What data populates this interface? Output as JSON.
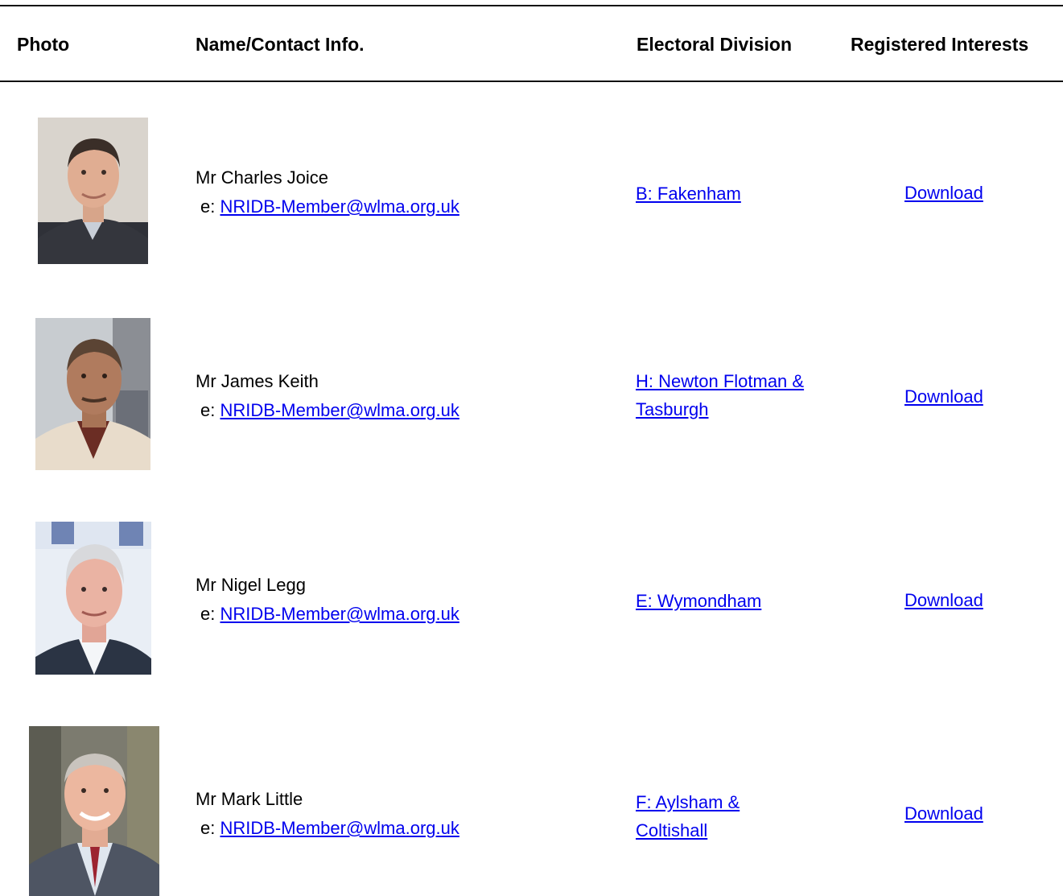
{
  "table": {
    "headers": {
      "photo": "Photo",
      "name": "Name/Contact Info.",
      "division": "Electoral Division",
      "interests": "Registered Interests"
    },
    "rows": [
      {
        "name": "Mr Charles Joice",
        "email_prefix": "e:",
        "email": "NRIDB-Member@wlma.org.uk",
        "division": "B: Fakenham",
        "interests_link": "Download"
      },
      {
        "name": "Mr James Keith",
        "email_prefix": "e:",
        "email": "NRIDB-Member@wlma.org.uk",
        "division": "H: Newton Flotman & Tasburgh",
        "interests_link": "Download"
      },
      {
        "name": "Mr Nigel Legg",
        "email_prefix": "e:",
        "email": "NRIDB-Member@wlma.org.uk",
        "division": "E: Wymondham",
        "interests_link": "Download"
      },
      {
        "name": "Mr Mark Little",
        "email_prefix": "e:",
        "email": "NRIDB-Member@wlma.org.uk",
        "division": "F: Aylsham & Coltishall",
        "interests_link": "Download"
      }
    ]
  },
  "colors": {
    "link": "#0000ee",
    "text": "#000000",
    "rule": "#111111"
  }
}
